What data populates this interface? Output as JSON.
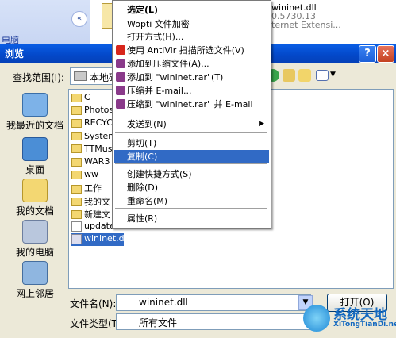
{
  "background": {
    "panel_button": "«",
    "panel_link": "电脑",
    "file_name": "wininet.dll",
    "file_version": "0.5730.13",
    "file_desc": "ternet Extensi..."
  },
  "dialog": {
    "title": "浏览",
    "help_label": "?",
    "close_label": "×",
    "lookin_label": "查找范围(I):",
    "lookin_value": "本地磁",
    "places": {
      "recent": "我最近的文档",
      "desktop": "桌面",
      "docs": "我的文档",
      "computer": "我的电脑",
      "network": "网上邻居"
    },
    "files": [
      {
        "name": "C",
        "type": "folder"
      },
      {
        "name": "Photosh",
        "type": "folder"
      },
      {
        "name": "RECYCLE",
        "type": "folder"
      },
      {
        "name": "System",
        "type": "folder"
      },
      {
        "name": "TTMusic",
        "type": "folder"
      },
      {
        "name": "WAR3",
        "type": "folder"
      },
      {
        "name": "ww",
        "type": "folder"
      },
      {
        "name": "工作",
        "type": "folder"
      },
      {
        "name": "我的文",
        "type": "folder"
      },
      {
        "name": "新建文",
        "type": "folder"
      },
      {
        "name": "update.",
        "type": "doc"
      },
      {
        "name": "wininet.dll",
        "type": "dll",
        "selected": true
      }
    ],
    "filename_label": "文件名(N):",
    "filename_value": "wininet.dll",
    "filetype_label": "文件类型(T):",
    "filetype_value": "所有文件",
    "open_label": "打开(O)"
  },
  "context_menu": {
    "items": [
      {
        "label": "选定(L)",
        "bold": true
      },
      {
        "label": "Wopti 文件加密"
      },
      {
        "label": "打开方式(H)..."
      },
      {
        "label": "使用 AntiVir 扫描所选文件(V)",
        "icon": "antivir-icon"
      },
      {
        "label": "添加到压缩文件(A)...",
        "icon": "winrar-icon"
      },
      {
        "label": "添加到 \"wininet.rar\"(T)",
        "icon": "winrar-icon"
      },
      {
        "label": "压缩并 E-mail...",
        "icon": "winrar-icon"
      },
      {
        "label": "压缩到 \"wininet.rar\" 并 E-mail",
        "icon": "winrar-icon"
      },
      {
        "label": "发送到(N)",
        "submenu": true
      },
      {
        "label": "剪切(T)"
      },
      {
        "label": "复制(C)",
        "highlight": true
      },
      {
        "label": "创建快捷方式(S)"
      },
      {
        "label": "删除(D)"
      },
      {
        "label": "重命名(M)"
      },
      {
        "label": "属性(R)"
      }
    ]
  },
  "watermark": {
    "text": "系统天地",
    "url": "XiTongTianDi.net"
  },
  "colors": {
    "title_bar": "#0a5fe6",
    "selection": "#316ac5",
    "dialog_bg": "#ece9d8"
  }
}
